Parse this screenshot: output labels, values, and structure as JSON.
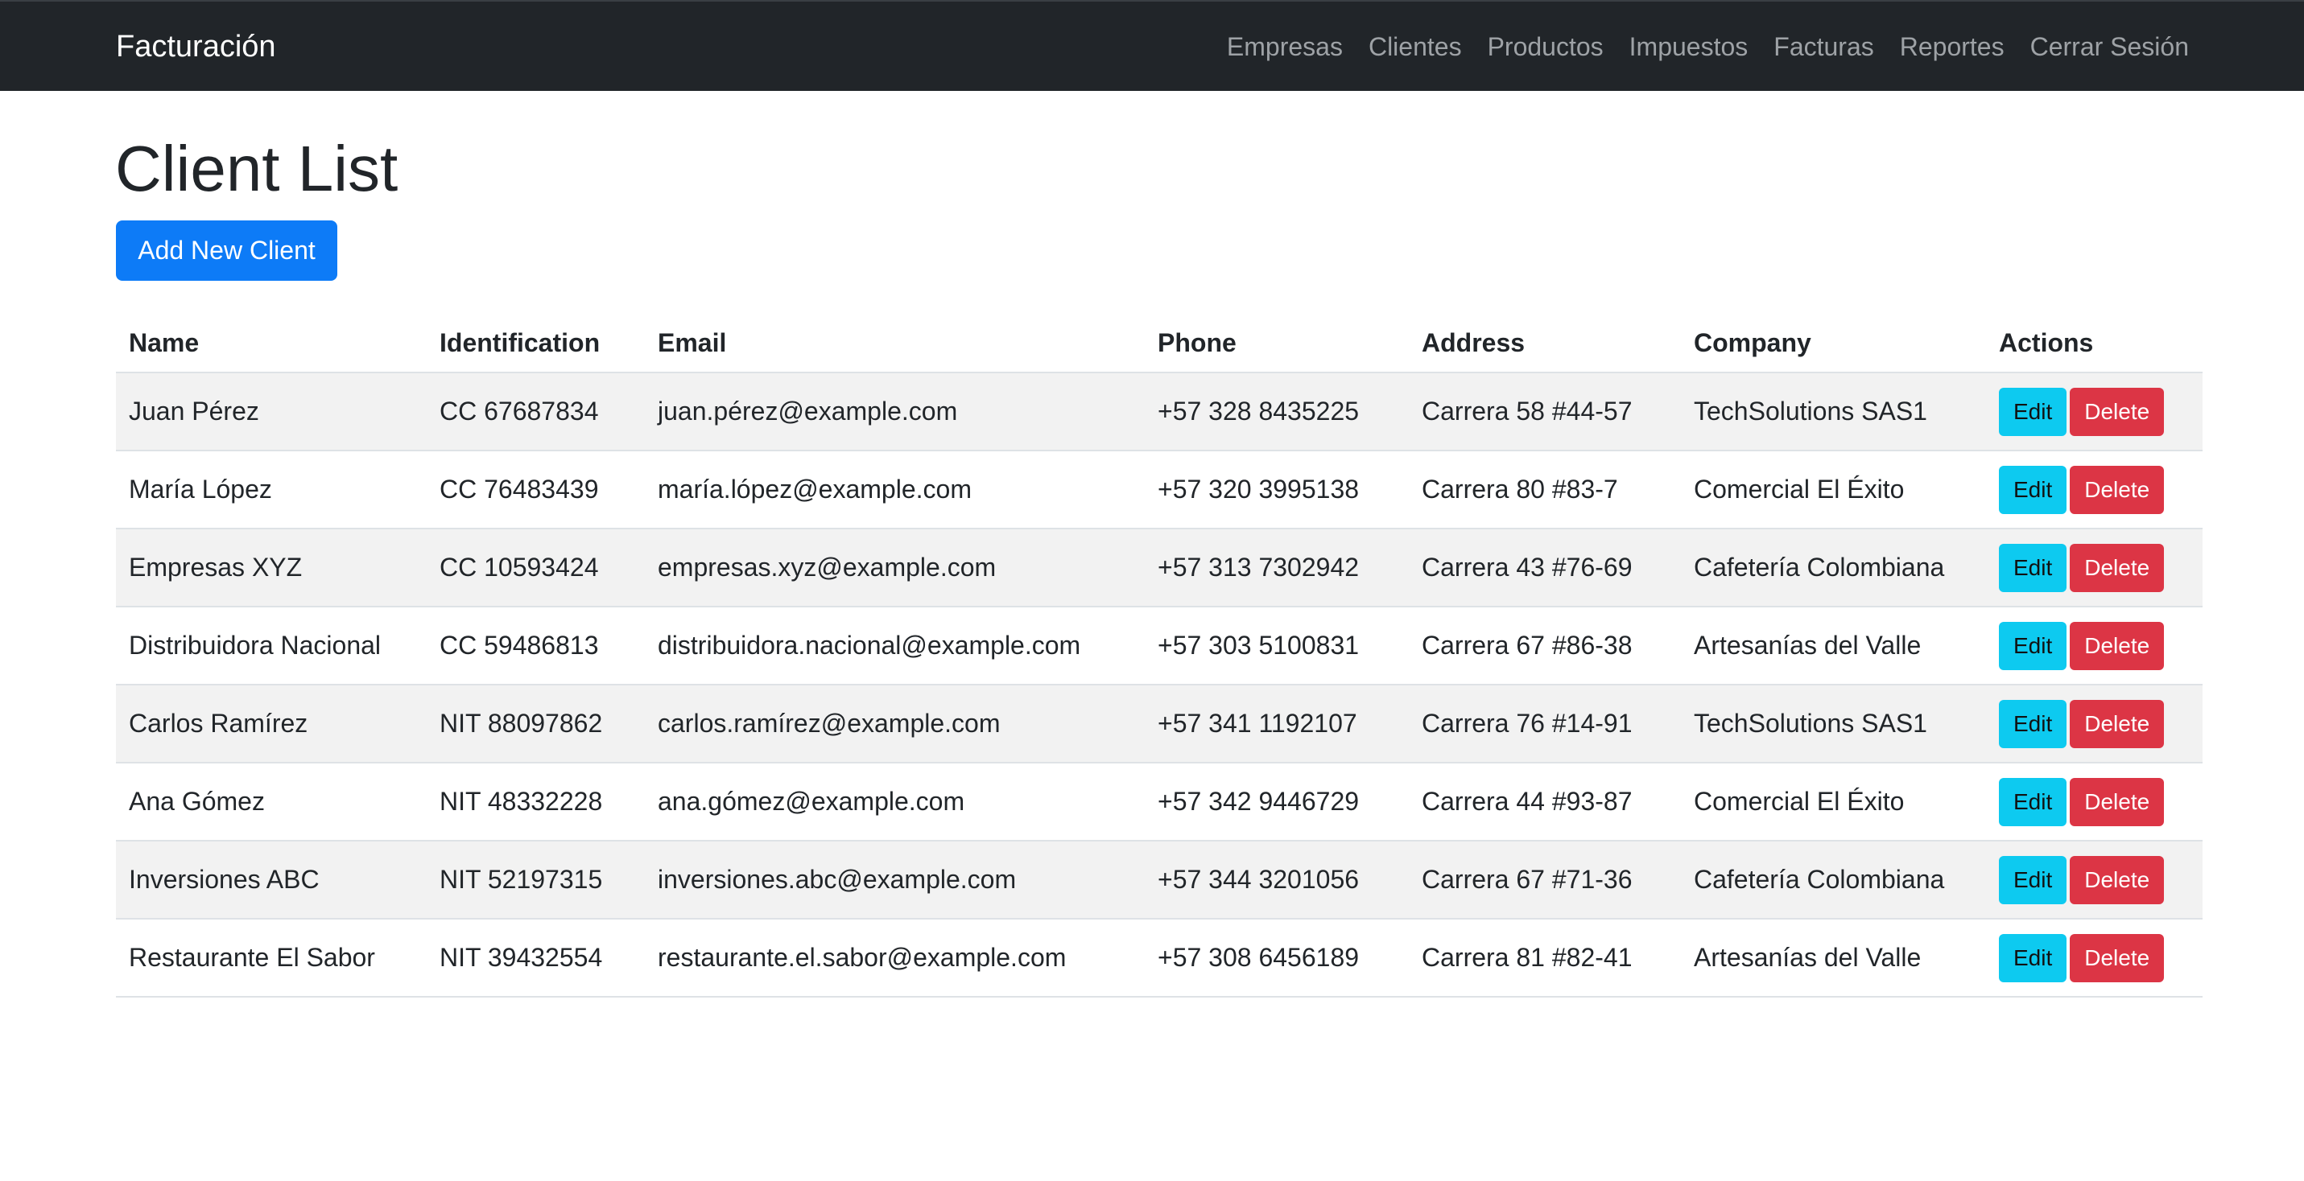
{
  "navbar": {
    "brand": "Facturación",
    "links": [
      "Empresas",
      "Clientes",
      "Productos",
      "Impuestos",
      "Facturas",
      "Reportes",
      "Cerrar Sesión"
    ]
  },
  "page": {
    "title": "Client List",
    "add_button": "Add New Client"
  },
  "table": {
    "headers": [
      "Name",
      "Identification",
      "Email",
      "Phone",
      "Address",
      "Company",
      "Actions"
    ],
    "edit_label": "Edit",
    "delete_label": "Delete",
    "rows": [
      [
        "Juan Pérez",
        "CC 67687834",
        "juan.pérez@example.com",
        "+57 328 8435225",
        "Carrera 58 #44-57",
        "TechSolutions SAS1"
      ],
      [
        "María López",
        "CC 76483439",
        "maría.lópez@example.com",
        "+57 320 3995138",
        "Carrera 80 #83-7",
        "Comercial El Éxito"
      ],
      [
        "Empresas XYZ",
        "CC 10593424",
        "empresas.xyz@example.com",
        "+57 313 7302942",
        "Carrera 43 #76-69",
        "Cafetería Colombiana"
      ],
      [
        "Distribuidora Nacional",
        "CC 59486813",
        "distribuidora.nacional@example.com",
        "+57 303 5100831",
        "Carrera 67 #86-38",
        "Artesanías del Valle"
      ],
      [
        "Carlos Ramírez",
        "NIT 88097862",
        "carlos.ramírez@example.com",
        "+57 341 1192107",
        "Carrera 76 #14-91",
        "TechSolutions SAS1"
      ],
      [
        "Ana Gómez",
        "NIT 48332228",
        "ana.gómez@example.com",
        "+57 342 9446729",
        "Carrera 44 #93-87",
        "Comercial El Éxito"
      ],
      [
        "Inversiones ABC",
        "NIT 52197315",
        "inversiones.abc@example.com",
        "+57 344 3201056",
        "Carrera 67 #71-36",
        "Cafetería Colombiana"
      ],
      [
        "Restaurante El Sabor",
        "NIT 39432554",
        "restaurante.el.sabor@example.com",
        "+57 308 6456189",
        "Carrera 81 #82-41",
        "Artesanías del Valle"
      ]
    ]
  },
  "colors": {
    "navbar_bg": "#212529",
    "primary": "#0d7bf7",
    "info": "#0dcaf0",
    "danger": "#dc3545",
    "stripe": "#f2f2f2"
  }
}
